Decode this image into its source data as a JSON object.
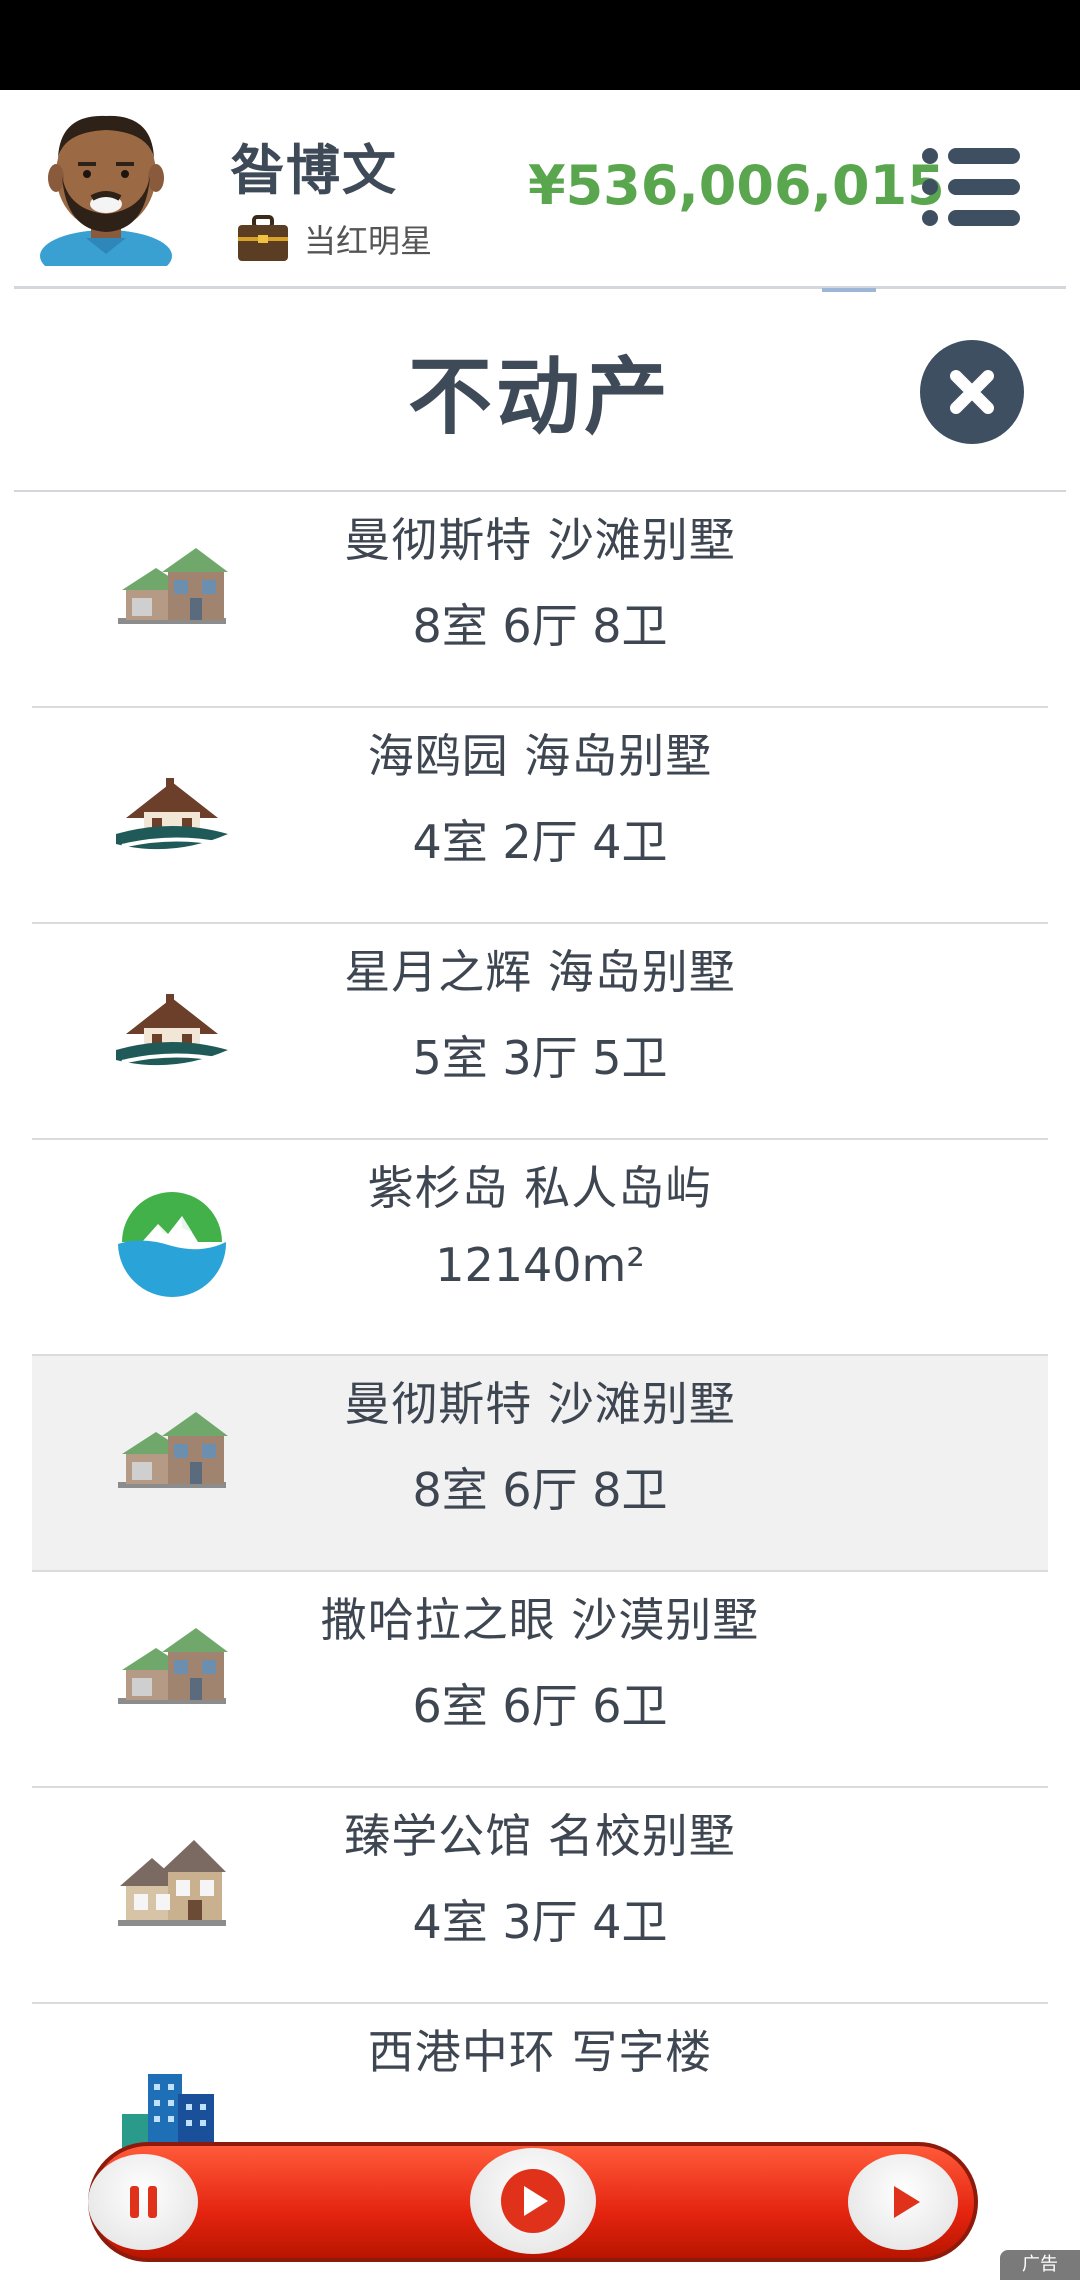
{
  "player": {
    "name": "昝博文",
    "job": "当红明星",
    "money": "¥536,006,015"
  },
  "panel": {
    "title": "不动产"
  },
  "properties": [
    {
      "name": "曼彻斯特 沙滩别墅",
      "detail": "8室 6厅 8卫",
      "icon": "villa-icon"
    },
    {
      "name": "海鸥园 海岛别墅",
      "detail": "4室 2厅 4卫",
      "icon": "island-house-icon"
    },
    {
      "name": "星月之辉 海岛别墅",
      "detail": "5室 3厅 5卫",
      "icon": "island-house-icon"
    },
    {
      "name": "紫杉岛 私人岛屿",
      "detail": "12140m²",
      "icon": "private-island-icon"
    },
    {
      "name": "曼彻斯特 沙滩别墅",
      "detail": "8室 6厅 8卫",
      "icon": "villa-icon"
    },
    {
      "name": "撒哈拉之眼 沙漠别墅",
      "detail": "6室 6厅 6卫",
      "icon": "villa-icon"
    },
    {
      "name": "臻学公馆 名校别墅",
      "detail": "4室 3厅 4卫",
      "icon": "school-house-icon"
    },
    {
      "name": "西港中环 写字楼",
      "detail": "",
      "icon": "office-building-icon"
    }
  ],
  "ad": {
    "label": "广告"
  },
  "colors": {
    "money": "#5aa64e",
    "title": "#3f4a58",
    "close_button": "#3f4f62",
    "ad_bar": "#e4240f"
  }
}
